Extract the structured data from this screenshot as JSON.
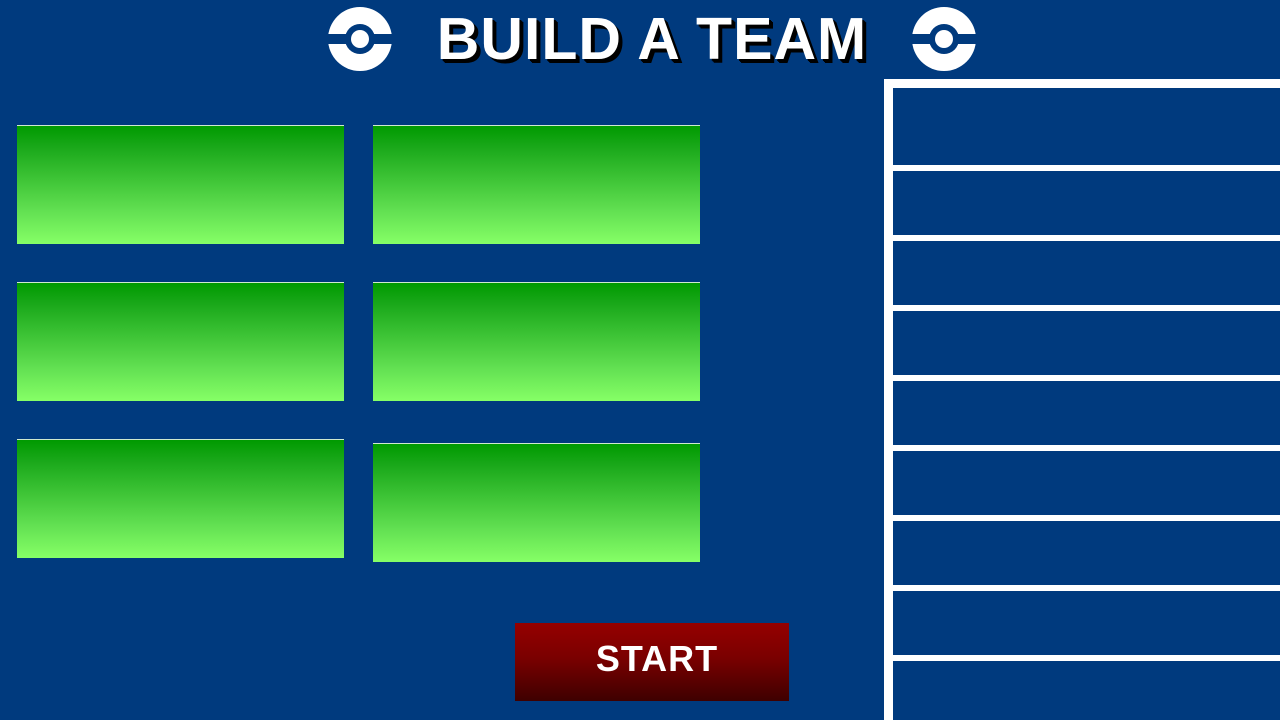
{
  "header": {
    "title": "BUILD A TEAM",
    "left_icon": "pokeball-icon",
    "right_icon": "pokeball-icon"
  },
  "team_slots": [
    {
      "label": ""
    },
    {
      "label": ""
    },
    {
      "label": ""
    },
    {
      "label": ""
    },
    {
      "label": ""
    },
    {
      "label": ""
    }
  ],
  "start_button": {
    "label": "START"
  },
  "roster": {
    "items": [
      {
        "label": ""
      },
      {
        "label": ""
      },
      {
        "label": ""
      },
      {
        "label": ""
      },
      {
        "label": ""
      },
      {
        "label": ""
      },
      {
        "label": ""
      },
      {
        "label": ""
      },
      {
        "label": ""
      }
    ]
  },
  "colors": {
    "background": "#003a7e",
    "slot_top": "#009a00",
    "slot_bottom": "#86ff66",
    "start_top": "#950000",
    "start_bottom": "#3e0000",
    "panel_border": "#ffffff",
    "title_text": "#ffffff",
    "title_shadow": "#000000"
  }
}
